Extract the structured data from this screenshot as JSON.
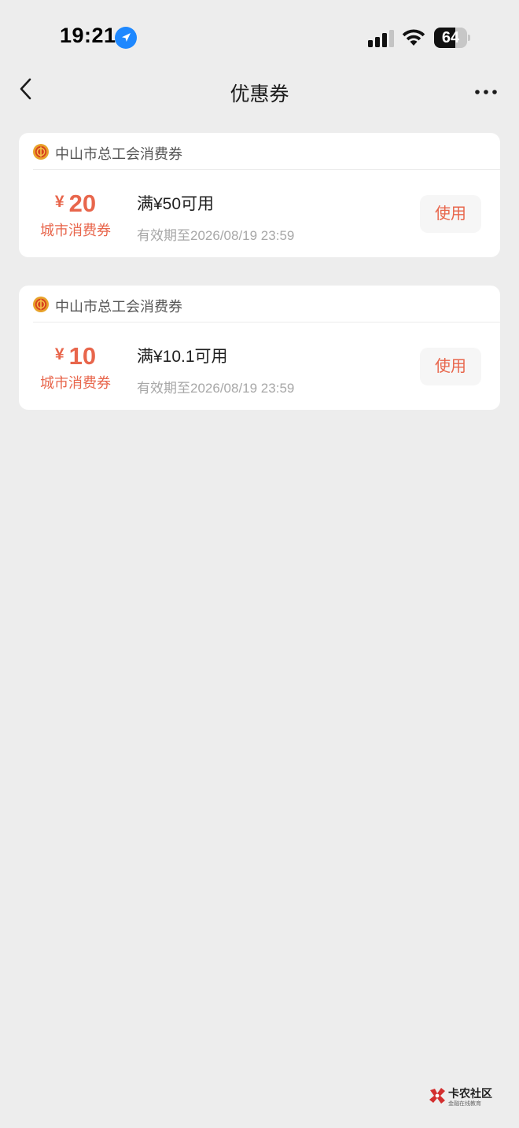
{
  "status_bar": {
    "time": "19:21",
    "battery_level": "64",
    "battery_fraction": 0.64,
    "location_icon": "location-arrow-icon",
    "signal_icon": "cellular-signal-icon",
    "wifi_icon": "wifi-icon"
  },
  "nav": {
    "title": "优惠券",
    "back_icon": "chevron-left-icon",
    "more_icon": "more-dots-icon"
  },
  "colors": {
    "accent": "#e8664c",
    "background": "#ededed",
    "card": "#ffffff",
    "location": "#1e88ff"
  },
  "coupons": [
    {
      "issuer": "中山市总工会消费券",
      "currency": "¥",
      "amount": "20",
      "type": "城市消费券",
      "condition": "满¥50可用",
      "expiry": "有效期至2026/08/19 23:59",
      "button_label": "使用"
    },
    {
      "issuer": "中山市总工会消费券",
      "currency": "¥",
      "amount": "10",
      "type": "城市消费券",
      "condition": "满¥10.1可用",
      "expiry": "有效期至2026/08/19 23:59",
      "button_label": "使用"
    }
  ],
  "watermark": {
    "name": "卡农社区",
    "tagline": "金融在线教育"
  }
}
